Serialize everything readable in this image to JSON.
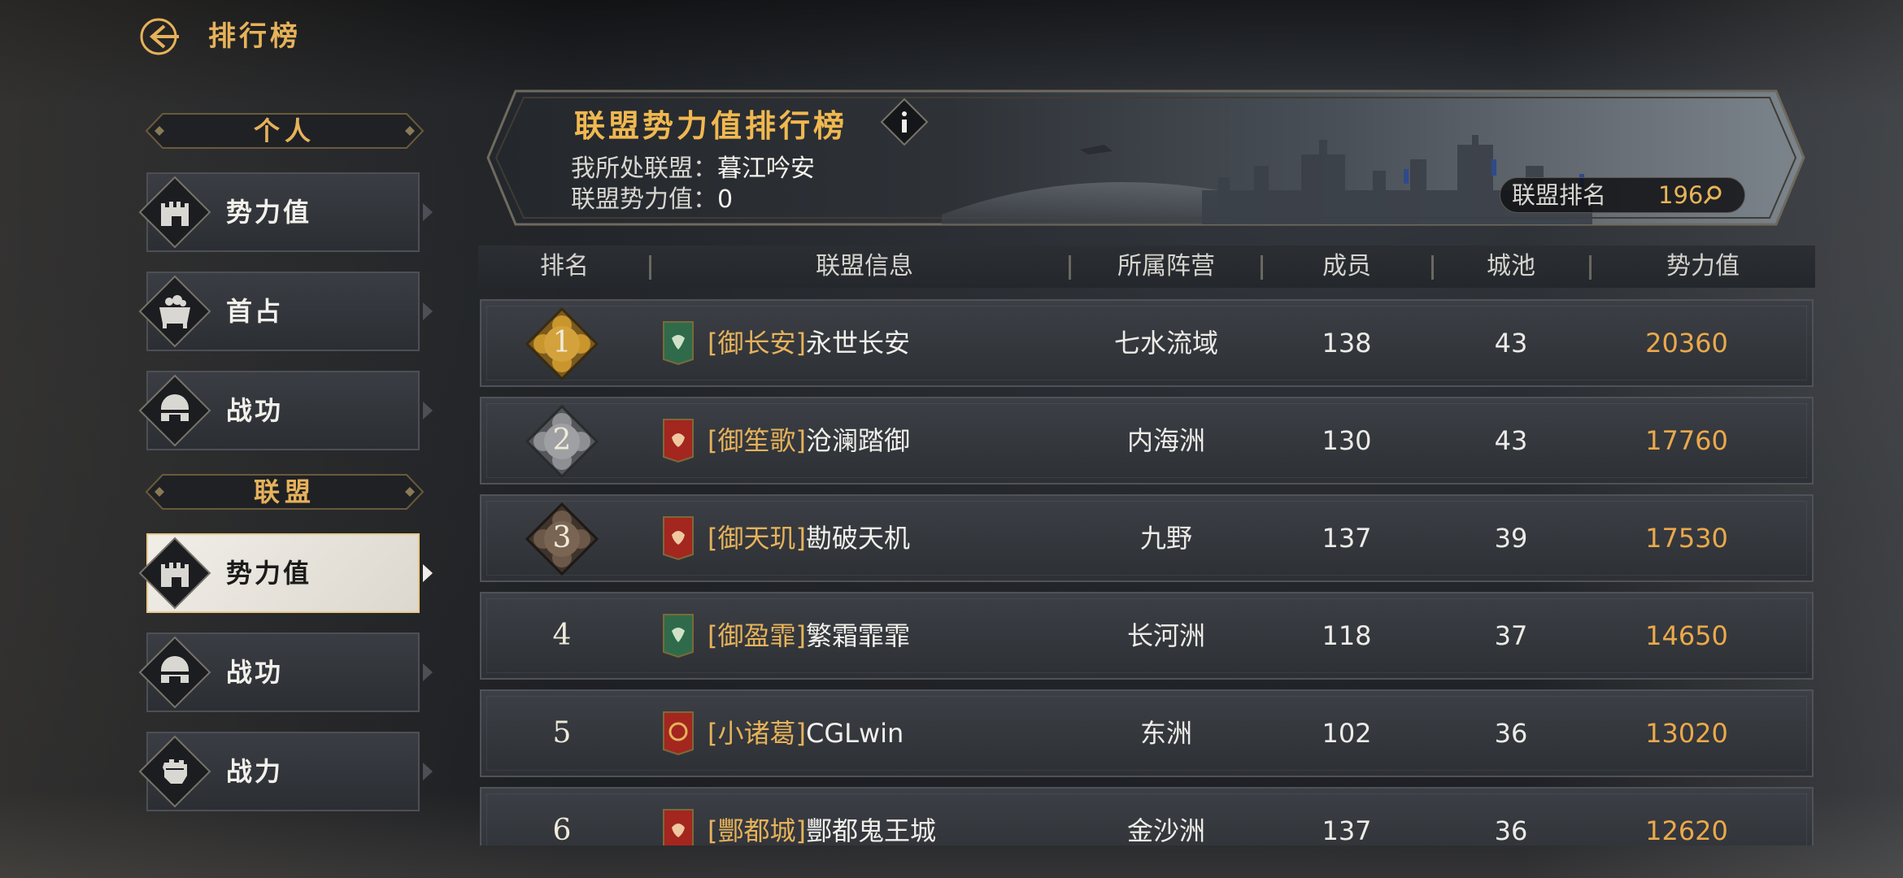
{
  "header": {
    "title": "排行榜",
    "back_icon": "back-arrow-icon"
  },
  "sidebar": {
    "personal_header": "个人",
    "personal_items": [
      {
        "label": "势力值",
        "icon": "castle-icon"
      },
      {
        "label": "首占",
        "icon": "cauldron-icon"
      },
      {
        "label": "战功",
        "icon": "helmet-icon"
      }
    ],
    "alliance_header": "联盟",
    "alliance_items": [
      {
        "label": "势力值",
        "icon": "castle-icon",
        "active": true
      },
      {
        "label": "战功",
        "icon": "helmet-icon"
      },
      {
        "label": "战力",
        "icon": "fist-icon"
      }
    ]
  },
  "banner": {
    "title": "联盟势力值排行榜",
    "my_alliance_label": "我所处联盟：",
    "my_alliance_value": "暮江吟安",
    "power_label": "联盟势力值：",
    "power_value": "0",
    "rank_label": "联盟排名",
    "rank_value": "196"
  },
  "table": {
    "headers": [
      "排名",
      "联盟信息",
      "所属阵营",
      "成员",
      "城池",
      "势力值"
    ],
    "rows": [
      {
        "rank": "1",
        "tag": "[御长安]",
        "name": "永世长安",
        "camp": "七水流域",
        "members": "138",
        "cities": "43",
        "power": "20360",
        "flag": "green"
      },
      {
        "rank": "2",
        "tag": "[御笙歌]",
        "name": "沧澜踏御",
        "camp": "内海洲",
        "members": "130",
        "cities": "43",
        "power": "17760",
        "flag": "red"
      },
      {
        "rank": "3",
        "tag": "[御天玑]",
        "name": "勘破天机",
        "camp": "九野",
        "members": "137",
        "cities": "39",
        "power": "17530",
        "flag": "red"
      },
      {
        "rank": "4",
        "tag": "[御盈霏]",
        "name": "繁霜霏霏",
        "camp": "长河洲",
        "members": "118",
        "cities": "37",
        "power": "14650",
        "flag": "green"
      },
      {
        "rank": "5",
        "tag": "[小诸葛]",
        "name": "CGLwin",
        "camp": "东洲",
        "members": "102",
        "cities": "36",
        "power": "13020",
        "flag": "red"
      },
      {
        "rank": "6",
        "tag": "[酆都城]",
        "name": "酆都鬼王城",
        "camp": "金沙洲",
        "members": "137",
        "cities": "36",
        "power": "12620",
        "flag": "red"
      }
    ]
  },
  "colors": {
    "gold_accent": "#e6b25a",
    "power_value": "#eba94a",
    "flag_green": "#2f6b4a",
    "flag_red": "#a3261f",
    "medal_gold": "#c9962e",
    "medal_silver": "#8e8f92",
    "medal_bronze": "#6b5848"
  }
}
